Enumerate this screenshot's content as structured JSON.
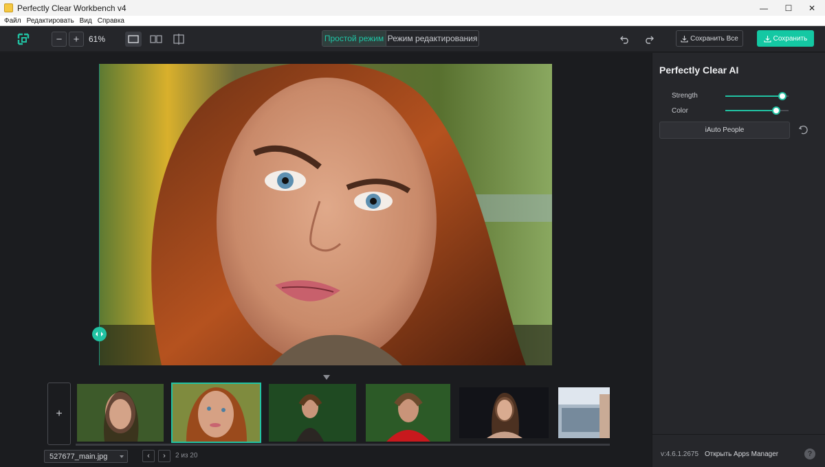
{
  "window": {
    "title": "Perfectly Clear Workbench v4",
    "controls": {
      "minimize": "—",
      "maximize": "☐",
      "close": "✕"
    }
  },
  "menu": [
    "Файл",
    "Редактировать",
    "Вид",
    "Справка"
  ],
  "toolbar": {
    "zoom_out_label": "−",
    "zoom_in_label": "+",
    "zoom_value": "61%",
    "modes": {
      "simple": "Простой режим",
      "edit": "Режим редактирования"
    },
    "save_all_label": "Сохранить Все",
    "save_label": "Сохранить",
    "accent_color": "#14c8a3"
  },
  "filmstrip": {
    "add_label": "+",
    "selected_index": 1,
    "thumbnail_count_visible": 6,
    "file_name": "527677_main.jpg",
    "prev_label": "‹",
    "next_label": "›",
    "page_count": "2 из 20"
  },
  "panel": {
    "title": "Perfectly Clear AI",
    "sliders": [
      {
        "label": "Strength",
        "value": 0.9
      },
      {
        "label": "Color",
        "value": 0.8
      }
    ],
    "preset_button": "iAuto People",
    "version": "v:4.6.1.2675",
    "apps_link": "Открыть Apps Manager",
    "help_label": "?"
  }
}
